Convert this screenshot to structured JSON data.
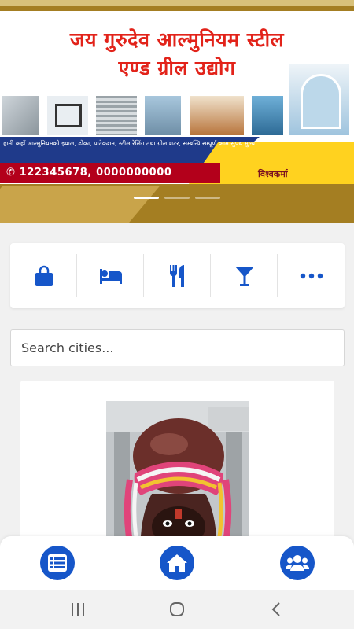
{
  "banner": {
    "title_line1": "जय गुरुदेव आल्मुनियम स्टील",
    "title_line2": "एण्ड ग्रील उद्योग",
    "description": "हामी कहाँ आल्मुनियमको झ्याल, ढोका, पाटेकशन, स्टील रेलिंग तथा ग्रील शटर, सम्बन्धि सम्पूर्ण काम सुपथ मुल्यमा गरिन्छ",
    "phone": "122345678, 0000000000",
    "brand": "विश्वकर्मा",
    "slides": 3,
    "active_slide": 0
  },
  "categories": [
    {
      "name": "shopping",
      "icon": "shopping-bag-icon"
    },
    {
      "name": "hotels",
      "icon": "bed-icon"
    },
    {
      "name": "restaurants",
      "icon": "utensils-icon"
    },
    {
      "name": "bars",
      "icon": "cocktail-icon"
    },
    {
      "name": "more",
      "icon": "more-horizontal-icon"
    }
  ],
  "search": {
    "placeholder": "Search cities..."
  },
  "bottom_nav": [
    {
      "name": "list",
      "icon": "list-icon"
    },
    {
      "name": "home",
      "icon": "home-icon"
    },
    {
      "name": "community",
      "icon": "users-icon"
    }
  ],
  "system_nav": [
    {
      "name": "recents",
      "icon": "recents-icon"
    },
    {
      "name": "home",
      "icon": "circle-home-icon"
    },
    {
      "name": "back",
      "icon": "back-chevron-icon"
    }
  ],
  "colors": {
    "accent": "#1656c9",
    "hero_gold": "#a47e22",
    "banner_red": "#e2231a"
  }
}
